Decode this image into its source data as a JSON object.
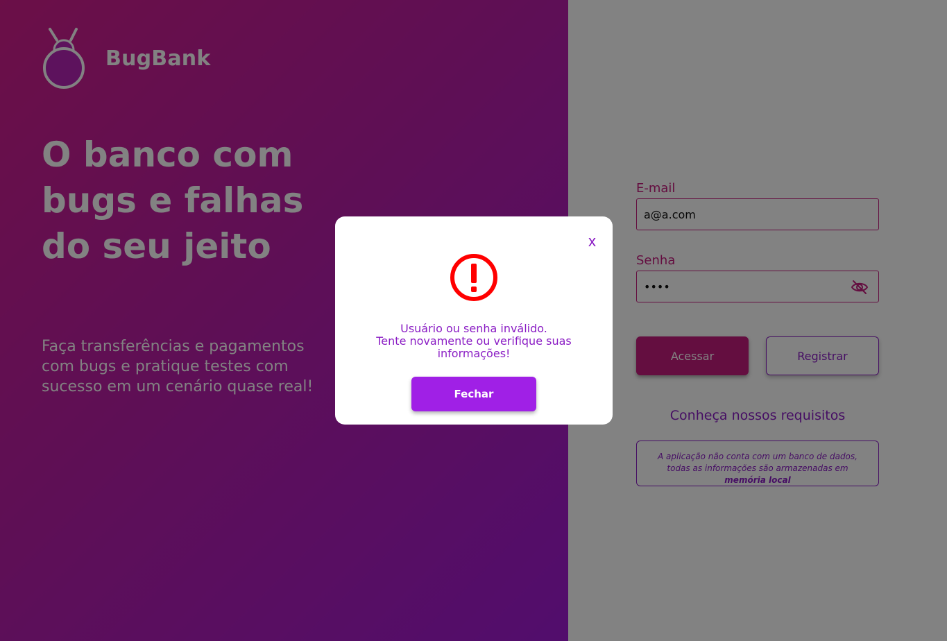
{
  "brand": {
    "name": "BugBank",
    "icon": "bug-logo-icon"
  },
  "hero": {
    "title_line1": "O banco com",
    "title_line2": "bugs e falhas",
    "title_line3": "do seu jeito",
    "subtitle": "Faça transferências e pagamentos com bugs e pratique testes com sucesso em um cenário quase real!"
  },
  "login": {
    "email_label": "E-mail",
    "email_value": "a@a.com",
    "password_label": "Senha",
    "password_value": "••••",
    "access_button": "Acessar",
    "register_button": "Registrar",
    "requirements_link": "Conheça nossos requisitos",
    "info_text": "A aplicação não conta com um banco de dados, todas as informações são armazenadas em",
    "info_bold": "memória local"
  },
  "modal": {
    "close_label": "x",
    "icon": "alert-circle-icon",
    "line1": "Usuário ou senha inválido.",
    "line2": "Tente novamente ou verifique suas",
    "line3": "informações!",
    "button": "Fechar"
  },
  "colors": {
    "primary": "#c51c7f",
    "secondary": "#8a1cc4",
    "button_modal": "#a020e6",
    "alert": "#ff0000"
  }
}
